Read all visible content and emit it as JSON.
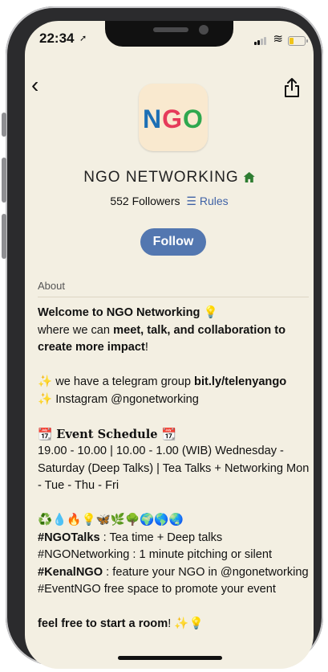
{
  "status": {
    "time": "22:34",
    "location_icon": "location-arrow-icon",
    "wifi_icon": "wifi-icon"
  },
  "nav": {
    "back_icon": "back-chevron-icon",
    "share_icon": "share-icon"
  },
  "club": {
    "logo_letters": [
      "N",
      "G",
      "O"
    ],
    "logo_colors": [
      "#1d6fb5",
      "#e63b5a",
      "#2fa84f"
    ],
    "name": "NGO NETWORKING",
    "followers": "552 Followers",
    "rules_label": "Rules",
    "follow_label": "Follow"
  },
  "about": {
    "label": "About",
    "l1_bold": "Welcome to NGO Networking",
    "l1_emoji": "💡",
    "l2_pre": "where we can ",
    "l2_bold": "meet, talk, and collaboration to",
    "l3_bold": "create more impact",
    "l3_post": "!",
    "tg_emoji": "✨",
    "tg_pre": " we have a telegram group ",
    "tg_link": "bit.ly/telenyango",
    "ig": "✨ Instagram @ngonetworking",
    "event_title": "📆 Event Schedule 📆",
    "event_desc": "19.00 - 10.00 | 10.00 - 1.00 (WIB) Wednesday - Saturday (Deep Talks) | Tea Talks + Networking Mon - Tue - Thu - Fri",
    "emoji_row": "♻️💧🔥💡🦋🌿🌳🌍🌎🌏",
    "tag1_bold": "#NGOTalks",
    "tag1_rest": " : Tea time + Deep talks",
    "tag2": "#NGONetworking : 1 minute pitching or silent",
    "tag3_bold": "#KenalNGO",
    "tag3_rest": " : feature your NGO in @ngonetworking",
    "tag4": "#EventNGO free space to promote your event",
    "last_bold": "feel free to start a room",
    "last_rest": "! ✨💡"
  }
}
